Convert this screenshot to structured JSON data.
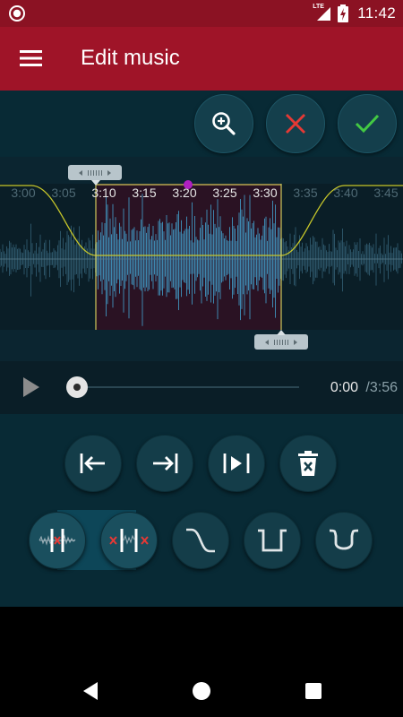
{
  "status_bar": {
    "time": "11:42",
    "network_label": "LTE",
    "icons": [
      "record-icon",
      "lte-signal-icon",
      "battery-charging-icon"
    ]
  },
  "app_bar": {
    "title": "Edit music",
    "icon": "hamburger-menu-icon"
  },
  "toolbar": {
    "buttons": [
      {
        "name": "zoom-in",
        "icon": "zoom-in-icon"
      },
      {
        "name": "cancel",
        "icon": "close-icon",
        "color": "#e53935"
      },
      {
        "name": "confirm",
        "icon": "check-icon",
        "color": "#43c943"
      }
    ]
  },
  "waveform": {
    "timeline_labels": [
      "3:00",
      "3:05",
      "3:10",
      "3:15",
      "3:20",
      "3:25",
      "3:30",
      "3:35",
      "3:40",
      "3:45"
    ],
    "selection_start": "3:10",
    "selection_end": "3:30",
    "playhead": "3:20",
    "colors": {
      "wave_selected": "#3d86ad",
      "wave_unselected": "#2b5366",
      "selection_bg": "#2a1223",
      "fade_curve": "#c7c72a",
      "playhead_marker": "#b020c0"
    }
  },
  "player": {
    "current_time": "0:00",
    "total_time": "/3:56",
    "progress": 0
  },
  "controls": {
    "row1": [
      {
        "name": "jump-to-start",
        "icon": "move-start-icon"
      },
      {
        "name": "jump-to-end",
        "icon": "move-end-icon"
      },
      {
        "name": "play-selection",
        "icon": "play-selection-icon"
      },
      {
        "name": "delete-selection",
        "icon": "delete-icon"
      }
    ],
    "row2": [
      {
        "name": "cut-inside",
        "icon": "cut-inside-icon",
        "active": true
      },
      {
        "name": "cut-outside",
        "icon": "cut-outside-icon",
        "active": true
      },
      {
        "name": "fade-out",
        "icon": "fade-out-curve-icon"
      },
      {
        "name": "fade-in-out",
        "icon": "fade-square-icon"
      },
      {
        "name": "fade-u",
        "icon": "fade-u-curve-icon"
      }
    ]
  },
  "nav_bar": {
    "buttons": [
      "back-icon",
      "home-icon",
      "recents-icon"
    ]
  }
}
